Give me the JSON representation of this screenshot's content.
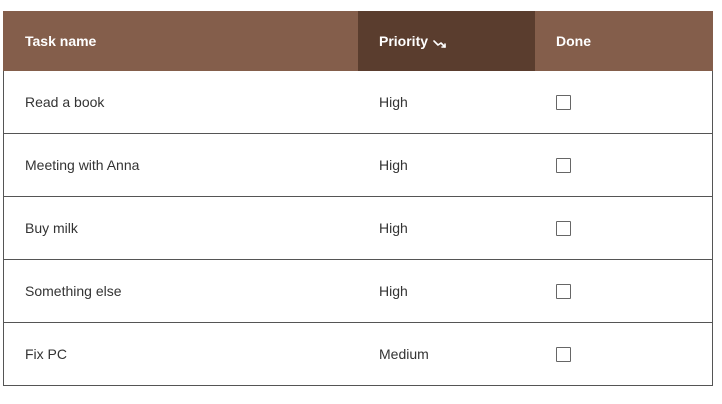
{
  "header": {
    "task_label": "Task name",
    "priority_label": "Priority",
    "done_label": "Done",
    "sort_icon": "sort-descending-icon"
  },
  "rows": [
    {
      "task": "Read a book",
      "priority": "High",
      "done": false
    },
    {
      "task": "Meeting with Anna",
      "priority": "High",
      "done": false
    },
    {
      "task": "Buy milk",
      "priority": "High",
      "done": false
    },
    {
      "task": "Something else",
      "priority": "High",
      "done": false
    },
    {
      "task": "Fix PC",
      "priority": "Medium",
      "done": false
    }
  ],
  "colors": {
    "header_bg": "#845e4b",
    "header_sorted_bg": "#5a3d2e",
    "header_text": "#ffffff",
    "row_border": "#555555"
  }
}
